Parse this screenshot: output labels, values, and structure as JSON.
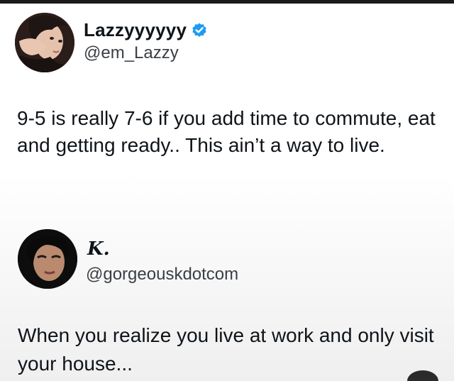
{
  "tweets": [
    {
      "display_name": "Lazzyyyyyy",
      "handle": "@em_Lazzy",
      "verified": true,
      "text": "9-5 is really 7-6 if you add time to commute, eat and getting ready.. This ain’t a way to live."
    },
    {
      "display_name": "K.",
      "handle": "@gorgeouskdotcom",
      "verified": false,
      "text": "When you realize you live at work and only visit your house..."
    }
  ],
  "colors": {
    "verified_badge": "#1d9bf0",
    "text": "#0f1419",
    "handle": "#3a3f44"
  },
  "icons": [
    "verified-badge-icon"
  ]
}
